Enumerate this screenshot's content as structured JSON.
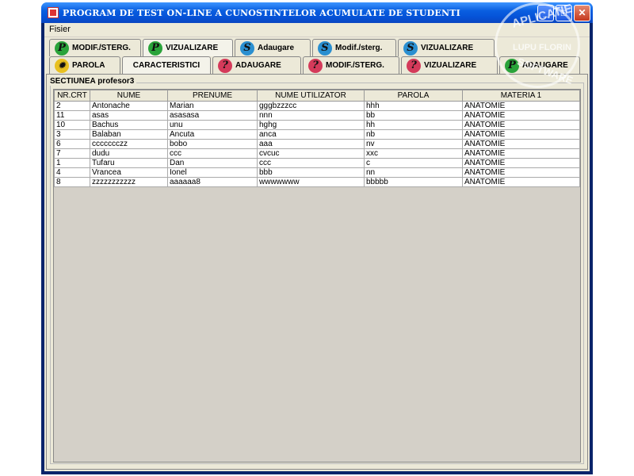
{
  "window": {
    "title": "PROGRAM DE TEST ON-LINE A CUNOSTINTELOR ACUMULATE DE STUDENTI",
    "minimize": "_",
    "maximize": "□",
    "close": "✕"
  },
  "menu": {
    "fisier": "Fisier"
  },
  "tabs_row1": [
    {
      "icon": "P",
      "label": "MODIF./STERG."
    },
    {
      "icon": "P",
      "label": "VIZUALIZARE"
    },
    {
      "icon": "S",
      "label": "Adaugare"
    },
    {
      "icon": "S",
      "label": "Modif./sterg."
    },
    {
      "icon": "S",
      "label": "VIZUALIZARE"
    }
  ],
  "tabs_row2": [
    {
      "icon": "gear",
      "label": "PAROLA"
    },
    {
      "icon": "",
      "label": "CARACTERISTICI"
    },
    {
      "icon": "?",
      "label": "ADAUGARE"
    },
    {
      "icon": "?",
      "label": "MODIF./STERG."
    },
    {
      "icon": "?",
      "label": "VIZUALIZARE"
    },
    {
      "icon": "P",
      "label": "ADAUGARE"
    }
  ],
  "section": {
    "title": "SECTIUNEA profesor3"
  },
  "table": {
    "headers": [
      "NR.CRT",
      "NUME",
      "PRENUME",
      "NUME UTILIZATOR",
      "PAROLA",
      "MATERIA 1"
    ],
    "rows": [
      [
        "2",
        "Antonache",
        "Marian",
        "gggbzzzcc",
        "hhh",
        "ANATOMIE"
      ],
      [
        "11",
        "asas",
        "asasasa",
        "nnn",
        "bb",
        "ANATOMIE"
      ],
      [
        "10",
        "Bachus",
        "unu",
        "hghg",
        "hh",
        "ANATOMIE"
      ],
      [
        "3",
        "Balaban",
        "Ancuta",
        "anca",
        "nb",
        "ANATOMIE"
      ],
      [
        "6",
        "ccccccczz",
        "bobo",
        "aaa",
        "nv",
        "ANATOMIE"
      ],
      [
        "7",
        "dudu",
        "ccc",
        "cvcuc",
        "xxc",
        "ANATOMIE"
      ],
      [
        "1",
        "Tufaru",
        "Dan",
        "ccc",
        "c",
        "ANATOMIE"
      ],
      [
        "4",
        "Vrancea",
        "Ionel",
        "bbb",
        "nn",
        "ANATOMIE"
      ],
      [
        "8",
        "zzzzzzzzzzz",
        "aaaaaa8",
        "wwwwwww",
        "bbbbb",
        "ANATOMIE"
      ]
    ]
  },
  "watermark": {
    "line1": "APLICATIE",
    "line2": "LUPU FLORIN",
    "line3": "SOFTWARE"
  }
}
